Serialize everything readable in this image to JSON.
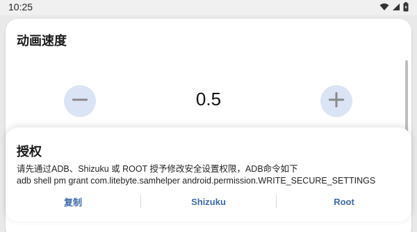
{
  "status_bar": {
    "time": "10:25",
    "icons": [
      "wifi-icon",
      "signal-icon",
      "battery-icon"
    ]
  },
  "speed_card": {
    "title": "动画速度",
    "value": "0.5",
    "decrease_icon": "minus-icon",
    "increase_icon": "plus-icon"
  },
  "auth_sheet": {
    "title": "授权",
    "message_line1": "请先通过ADB、Shizuku 或 ROOT 授予修改安全设置权限，ADB命令如下",
    "message_line2": "adb shell pm grant com.litebyte.samhelper android.permission.WRITE_SECURE_SETTINGS",
    "actions": [
      {
        "label": "复制"
      },
      {
        "label": "Shizuku"
      },
      {
        "label": "Root"
      }
    ]
  },
  "colors": {
    "accent": "#3e6aa8",
    "button_bg": "#dbe4f4",
    "icon_gray": "#8a8a8a"
  }
}
